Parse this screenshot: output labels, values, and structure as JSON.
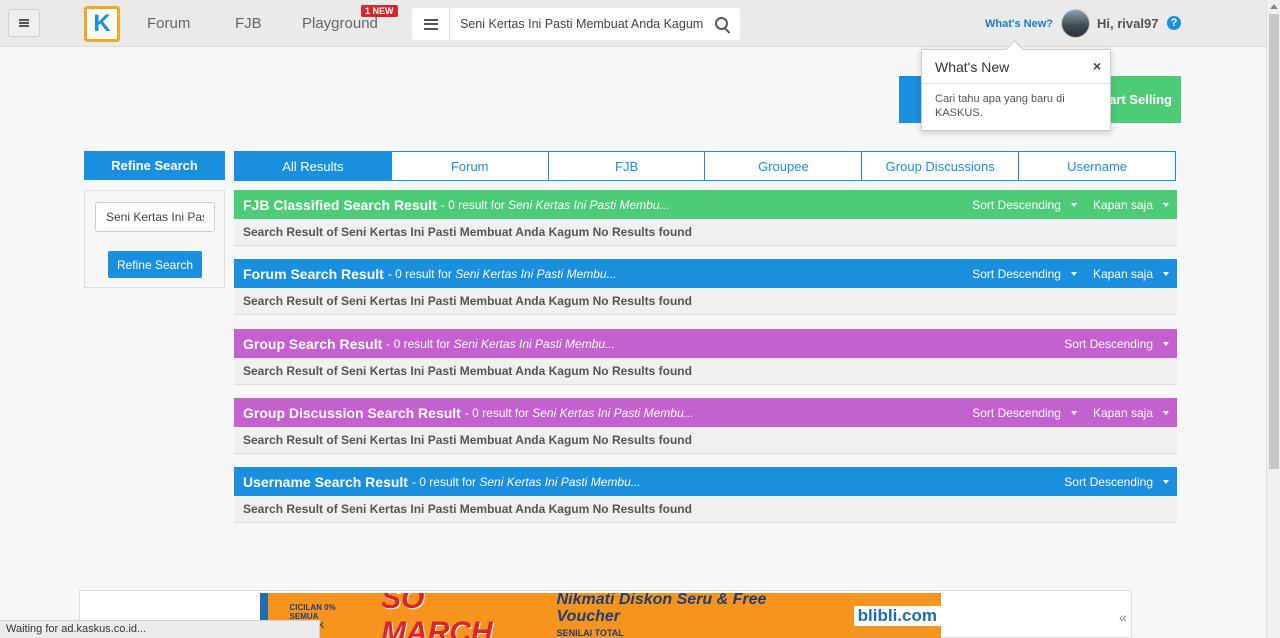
{
  "nav": {
    "forum": "Forum",
    "fjb": "FJB",
    "playground": "Playground",
    "new_badge": "1 NEW",
    "search_value": "Seni Kertas Ini Pasti Membuat Anda Kagum",
    "whats_new": "What's New?",
    "greeting": "Hi, rival97",
    "help": "?"
  },
  "sell": {
    "label": "Start Selling"
  },
  "popover": {
    "title": "What's New",
    "close": "×",
    "body": "Cari tahu apa yang baru di KASKUS."
  },
  "refine": {
    "header": "Refine Search",
    "input_value": "Seni Kertas Ini Pasti Membuat Anda Kagum",
    "button": "Refine Search"
  },
  "tabs": [
    "All Results",
    "Forum",
    "FJB",
    "Groupee",
    "Group Discussions",
    "Username"
  ],
  "sections": [
    {
      "title": "FJB Classified Search Result",
      "meta": "- 0 result for",
      "query": "Seni Kertas Ini Pasti Membu...",
      "sort": "Sort Descending",
      "time": "Kapan saja",
      "body": "Search Result of Seni Kertas Ini Pasti Membuat Anda Kagum No Results found",
      "color": "#4ecb77"
    },
    {
      "title": "Forum Search Result",
      "meta": "- 0 result for",
      "query": "Seni Kertas Ini Pasti Membu...",
      "sort": "Sort Descending",
      "time": "Kapan saja",
      "body": "Search Result of Seni Kertas Ini Pasti Membuat Anda Kagum No Results found",
      "color": "#1a8fe0"
    },
    {
      "title": "Group Search Result",
      "meta": "- 0 result for",
      "query": "Seni Kertas Ini Pasti Membu...",
      "sort": "Sort Descending",
      "body": "Search Result of Seni Kertas Ini Pasti Membuat Anda Kagum No Results found",
      "color": "#c460d0"
    },
    {
      "title": "Group Discussion Search Result",
      "meta": "- 0 result for",
      "query": "Seni Kertas Ini Pasti Membu...",
      "sort": "Sort Descending",
      "time": "Kapan saja",
      "body": "Search Result of Seni Kertas Ini Pasti Membuat Anda Kagum No Results found",
      "color": "#c460d0"
    },
    {
      "title": "Username Search Result",
      "meta": "- 0 result for",
      "query": "Seni Kertas Ini Pasti Membu...",
      "sort": "Sort Descending",
      "body": "Search Result of Seni Kertas Ini Pasti Membuat Anda Kagum No Results found",
      "color": "#1a8fe0"
    }
  ],
  "ad": {
    "cicilan": "CICILAN 0%",
    "cicilan_sub": "SEMUA PRODUK",
    "headline": "SO MARCH",
    "tagline": "Nikmati Diskon Seru & Free Voucher",
    "tagline_sub": "SENILAI TOTAL",
    "brand": "blibli.com"
  },
  "status": "Waiting for ad.kaskus.co.id..."
}
